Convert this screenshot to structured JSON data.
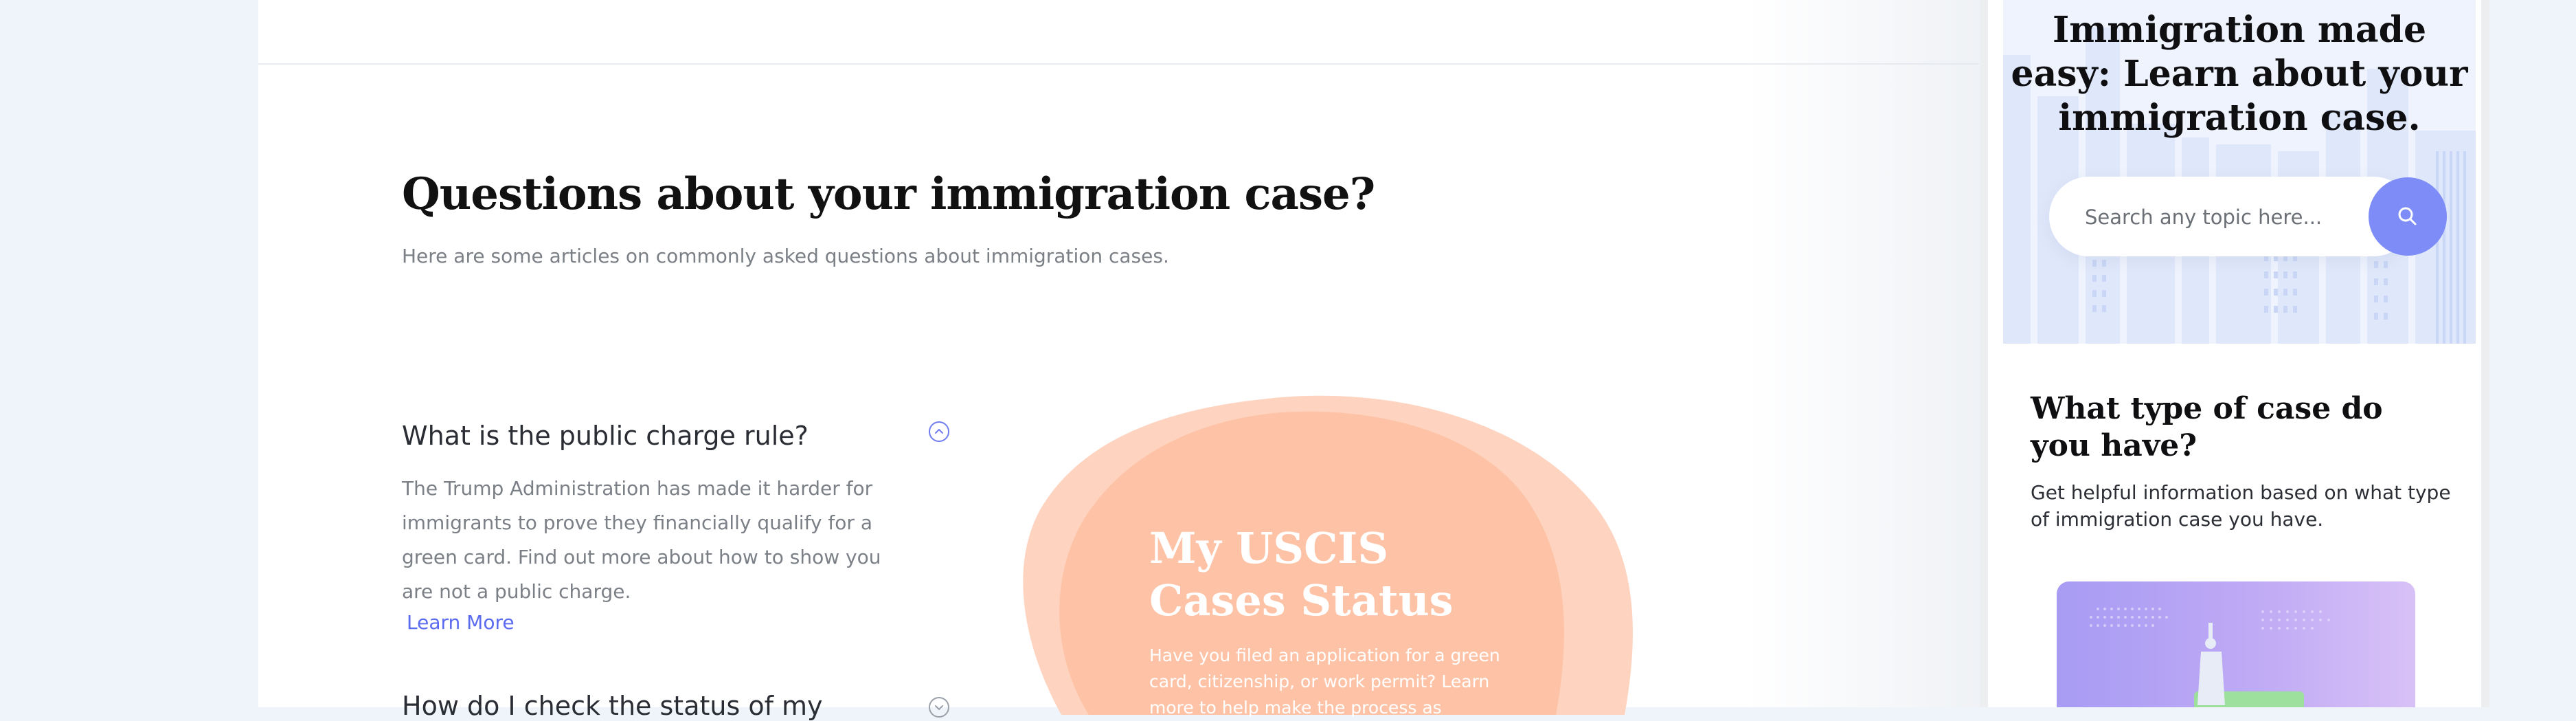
{
  "faq": {
    "title": "Questions about your immigration case?",
    "subtitle": "Here are some articles on commonly asked questions about immigration cases.",
    "questions": [
      {
        "title": "What is the public charge rule?",
        "body": "The Trump Administration has made it harder for immigrants to prove they financially qualify for a green card. Find out more about how to show you are not a public charge.",
        "link_label": "Learn More",
        "expanded": true
      },
      {
        "title": "How do I check the status of my",
        "expanded": false
      }
    ]
  },
  "status_card": {
    "title": "My USCIS Cases Status",
    "body": "Have you filed an application for a green card, citizenship, or work permit? Learn more to help make the process as"
  },
  "mobile": {
    "hero_title": "Immigration made easy: Learn about your immigration case.",
    "search": {
      "placeholder": "Search any topic here..."
    },
    "case_section": {
      "title": "What type of case do you have?",
      "subtitle": "Get helpful information based on what type of immigration case you have."
    }
  },
  "colors": {
    "accent": "#7d8cf7",
    "link": "#5a6bf0",
    "blob": "#fec3a6",
    "hero_bg": "#eef3fd",
    "page_bg": "#eff4fb"
  },
  "icons": [
    "chevron-up-icon",
    "chevron-down-icon",
    "search-icon",
    "statue-of-liberty-icon",
    "map-dots-icon"
  ]
}
